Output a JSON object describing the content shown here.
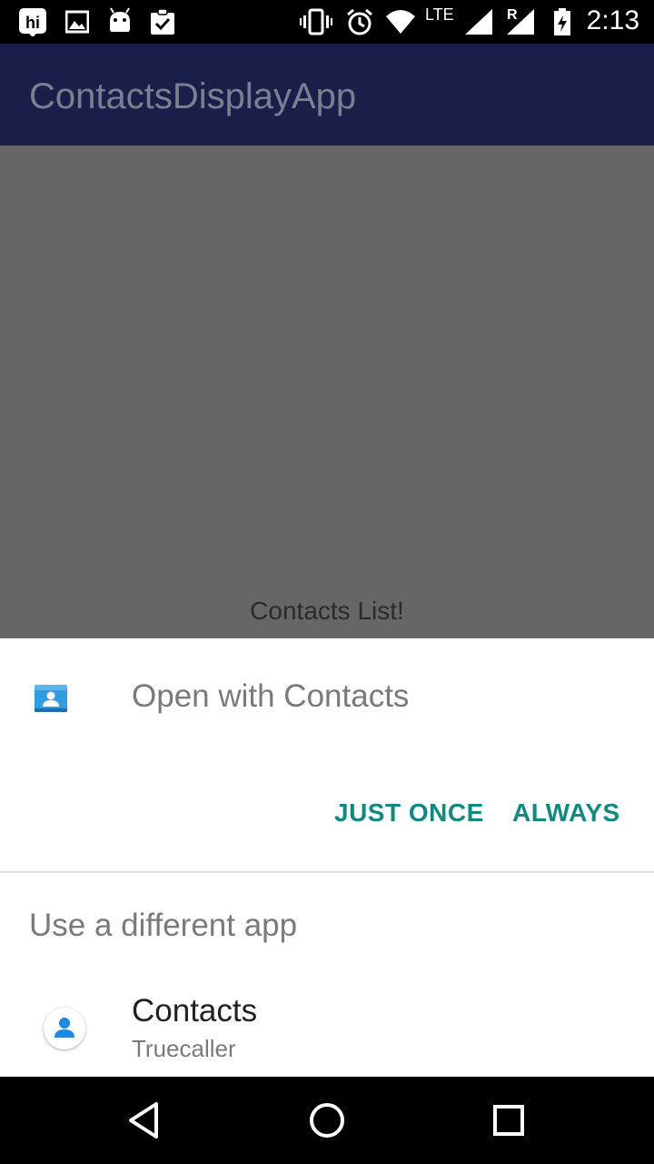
{
  "status_bar": {
    "time": "2:13",
    "network": "LTE",
    "roaming": "R",
    "icons": [
      "hi-app-icon",
      "image-icon",
      "android-icon",
      "clipboard-check-icon",
      "vibrate-icon",
      "alarm-icon",
      "wifi-icon",
      "signal-icon",
      "signal-roaming-icon",
      "battery-icon"
    ]
  },
  "app_bar": {
    "title": "ContactsDisplayApp"
  },
  "content": {
    "text": "Contacts List!"
  },
  "sheet": {
    "open_with": "Open with Contacts",
    "just_once": "JUST ONCE",
    "always": "ALWAYS",
    "use_different": "Use a different app",
    "apps": [
      {
        "name": "Contacts",
        "sub": "Truecaller",
        "icon": "truecaller-contacts-icon"
      }
    ]
  },
  "nav_bar": {
    "buttons": [
      "back-icon",
      "home-icon",
      "recents-icon"
    ]
  },
  "colors": {
    "accent": "#0e8a80",
    "app_bar": "#1a1f49",
    "scrim": "#666666"
  }
}
